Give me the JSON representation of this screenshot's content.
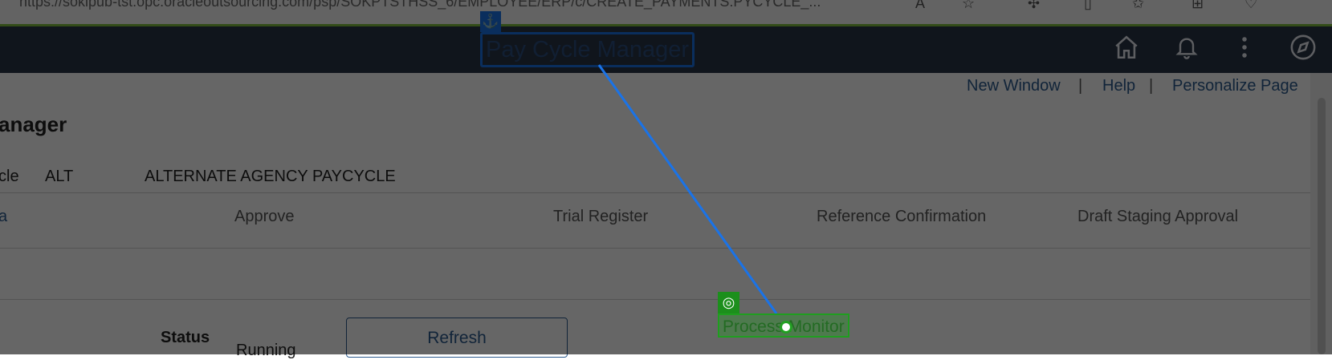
{
  "browser": {
    "url": "https://sokipub-tst.opc.oracleoutsourcing.com/psp/SOKPTSTHSS_6/EMPLOYEE/ERP/c/CREATE_PAYMENTS.PYCYCLE_..."
  },
  "header": {
    "title": "Pay Cycle Manager",
    "icons": [
      "home-icon",
      "bell-icon",
      "more-vertical-icon",
      "compass-icon"
    ]
  },
  "links": {
    "new_window": "New Window",
    "help": "Help",
    "personalize": "Personalize Page",
    "separator": "|"
  },
  "page": {
    "heading": "anager",
    "paycycle_label": "cle",
    "paycycle_code": "ALT",
    "paycycle_desc": "ALTERNATE AGENCY PAYCYCLE"
  },
  "steps": {
    "first": "a",
    "approve": "Approve",
    "trial_register": "Trial Register",
    "reference_confirmation": "Reference Confirmation",
    "draft_staging_approval": "Draft Staging Approval"
  },
  "status": {
    "label": "Status",
    "value": "Running",
    "refresh_button": "Refresh"
  },
  "annotation": {
    "target_label": "Process Monitor",
    "anchor_icon": "anchor-icon",
    "target_icon": "target-icon",
    "colors": {
      "anchor": "#1a73e8",
      "target": "#22a022"
    }
  }
}
